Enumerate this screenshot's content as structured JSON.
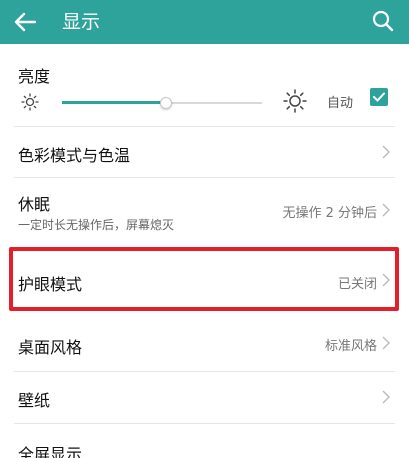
{
  "appbar": {
    "title": "显示",
    "back_icon": "arrow-left-icon",
    "search_icon": "search-icon",
    "color": "#2ea39c"
  },
  "brightness": {
    "label": "亮度",
    "auto_label": "自动",
    "auto_checked": true,
    "level_fraction": 0.52
  },
  "settings": [
    {
      "title": "色彩模式与色温"
    },
    {
      "title": "休眠",
      "subtitle": "一定时长无操作后，屏幕熄灭",
      "value": "无操作 2 分钟后"
    },
    {
      "title": "护眼模式",
      "value": "已关闭"
    },
    {
      "title": "桌面风格",
      "value": "标准风格"
    },
    {
      "title": "壁纸"
    },
    {
      "title": "全屏显示"
    }
  ],
  "highlight_color": "#e21f2b"
}
